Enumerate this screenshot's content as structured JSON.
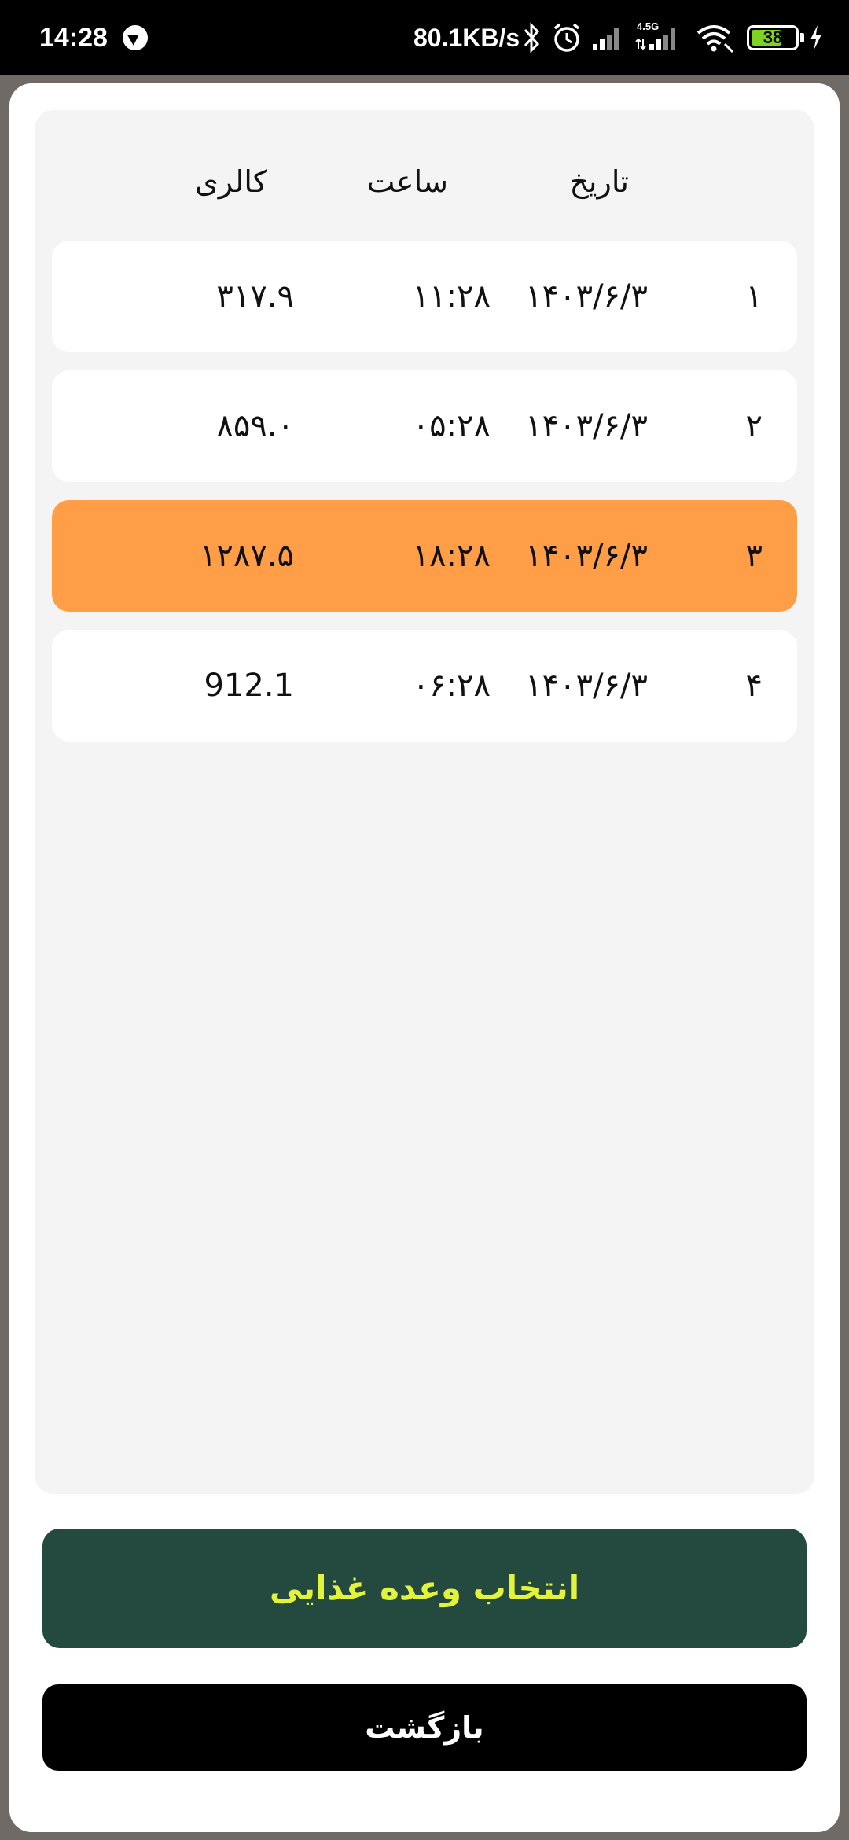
{
  "status_bar": {
    "time": "14:28",
    "network_speed": "80.1KB/s",
    "network_type": "4.5G",
    "battery_level": "38",
    "icons": [
      "telegram-icon",
      "bluetooth-icon",
      "alarm-icon",
      "signal-icon",
      "signal-4g-icon",
      "wifi-icon",
      "battery-icon",
      "charging-icon"
    ],
    "battery_color": "#7ed321"
  },
  "table": {
    "headers": {
      "date": "تاریخ",
      "time": "ساعت",
      "calories": "کالری"
    },
    "rows": [
      {
        "index": "۱",
        "date": "۱۴۰۳/۶/۳",
        "time": "۱۱:۲۸",
        "calories": "۳۱۷.۹",
        "selected": false
      },
      {
        "index": "۲",
        "date": "۱۴۰۳/۶/۳",
        "time": "۰۵:۲۸",
        "calories": "۸۵۹.۰",
        "selected": false
      },
      {
        "index": "۳",
        "date": "۱۴۰۳/۶/۳",
        "time": "۱۸:۲۸",
        "calories": "۱۲۸۷.۵",
        "selected": true
      },
      {
        "index": "۴",
        "date": "۱۴۰۳/۶/۳",
        "time": "۰۶:۲۸",
        "calories": "912.1",
        "selected": false
      }
    ],
    "selected_color": "#ff9e47"
  },
  "actions": {
    "select_meal_label": "انتخاب وعده غذایی",
    "back_label": "بازگشت",
    "select_meal_bg": "#244a3f",
    "select_meal_text_color": "#e3f23a"
  }
}
